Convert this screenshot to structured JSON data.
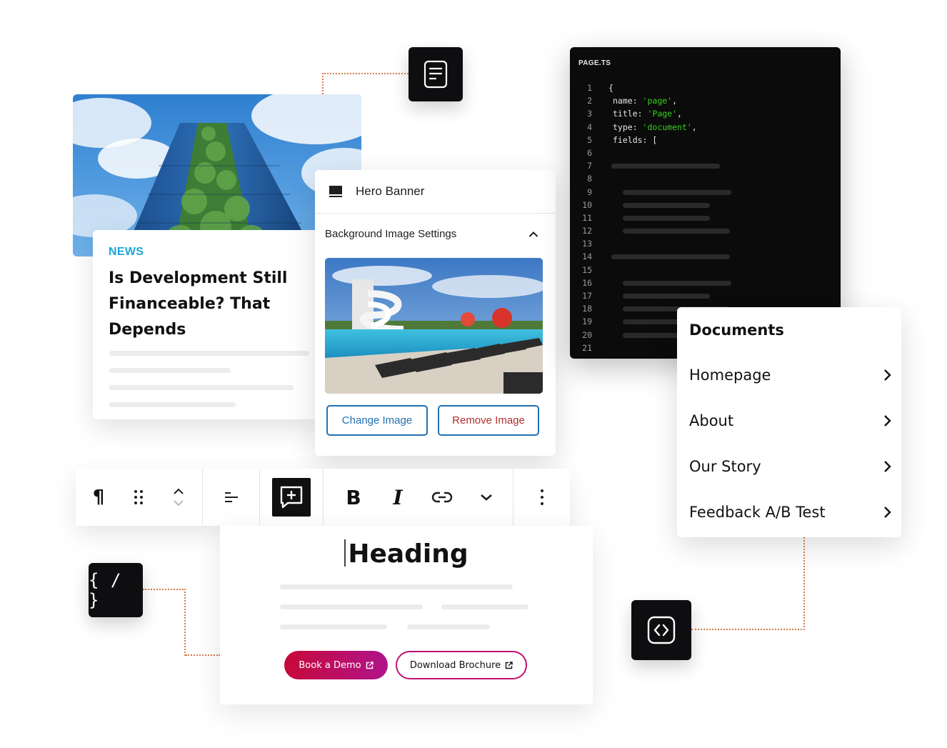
{
  "news_card": {
    "tag": "NEWS",
    "title": "Is Development Still Financeable? That Depends"
  },
  "hero_panel": {
    "title": "Hero Banner",
    "section_label": "Background Image Settings",
    "change_image_label": "Change Image",
    "remove_image_label": "Remove Image"
  },
  "code_panel": {
    "filename": "PAGE.TS",
    "lines": [
      {
        "num": "1",
        "text": "{"
      },
      {
        "num": "2",
        "key": "name: ",
        "value": "'page'",
        "tail": ","
      },
      {
        "num": "3",
        "key": "title: ",
        "value": "'Page'",
        "tail": ","
      },
      {
        "num": "4",
        "key": "type: ",
        "value": "'document'",
        "tail": ","
      },
      {
        "num": "5",
        "text": "fields: ["
      },
      {
        "num": "6"
      },
      {
        "num": "7"
      },
      {
        "num": "8"
      },
      {
        "num": "9"
      },
      {
        "num": "10"
      },
      {
        "num": "11"
      },
      {
        "num": "12"
      },
      {
        "num": "13"
      },
      {
        "num": "14"
      },
      {
        "num": "15"
      },
      {
        "num": "16"
      },
      {
        "num": "17"
      },
      {
        "num": "18"
      },
      {
        "num": "19"
      },
      {
        "num": "20"
      },
      {
        "num": "21"
      }
    ]
  },
  "documents_panel": {
    "title": "Documents",
    "items": [
      {
        "label": "Homepage"
      },
      {
        "label": "About"
      },
      {
        "label": "Our Story"
      },
      {
        "label": "Feedback A/B Test"
      }
    ]
  },
  "toolbar": {
    "paragraph_glyph": "¶",
    "bold_glyph": "B",
    "italic_glyph": "I"
  },
  "heading_card": {
    "heading": "Heading",
    "book_demo_label": "Book a Demo",
    "download_label": "Download Brochure"
  },
  "icons": {
    "document": "document-icon",
    "braces": "code-braces-icon",
    "code_block": "code-block-icon",
    "curly_glyph": "{ / }"
  },
  "colors": {
    "news_tag": "#1aa6d6",
    "code_string": "#34d11b",
    "wp_blue": "#2271b1",
    "remove_red": "#b32d2e",
    "brand_gradient_start": "#c7093a",
    "brand_gradient_end": "#b0148a",
    "connector": "#d97a4a"
  }
}
